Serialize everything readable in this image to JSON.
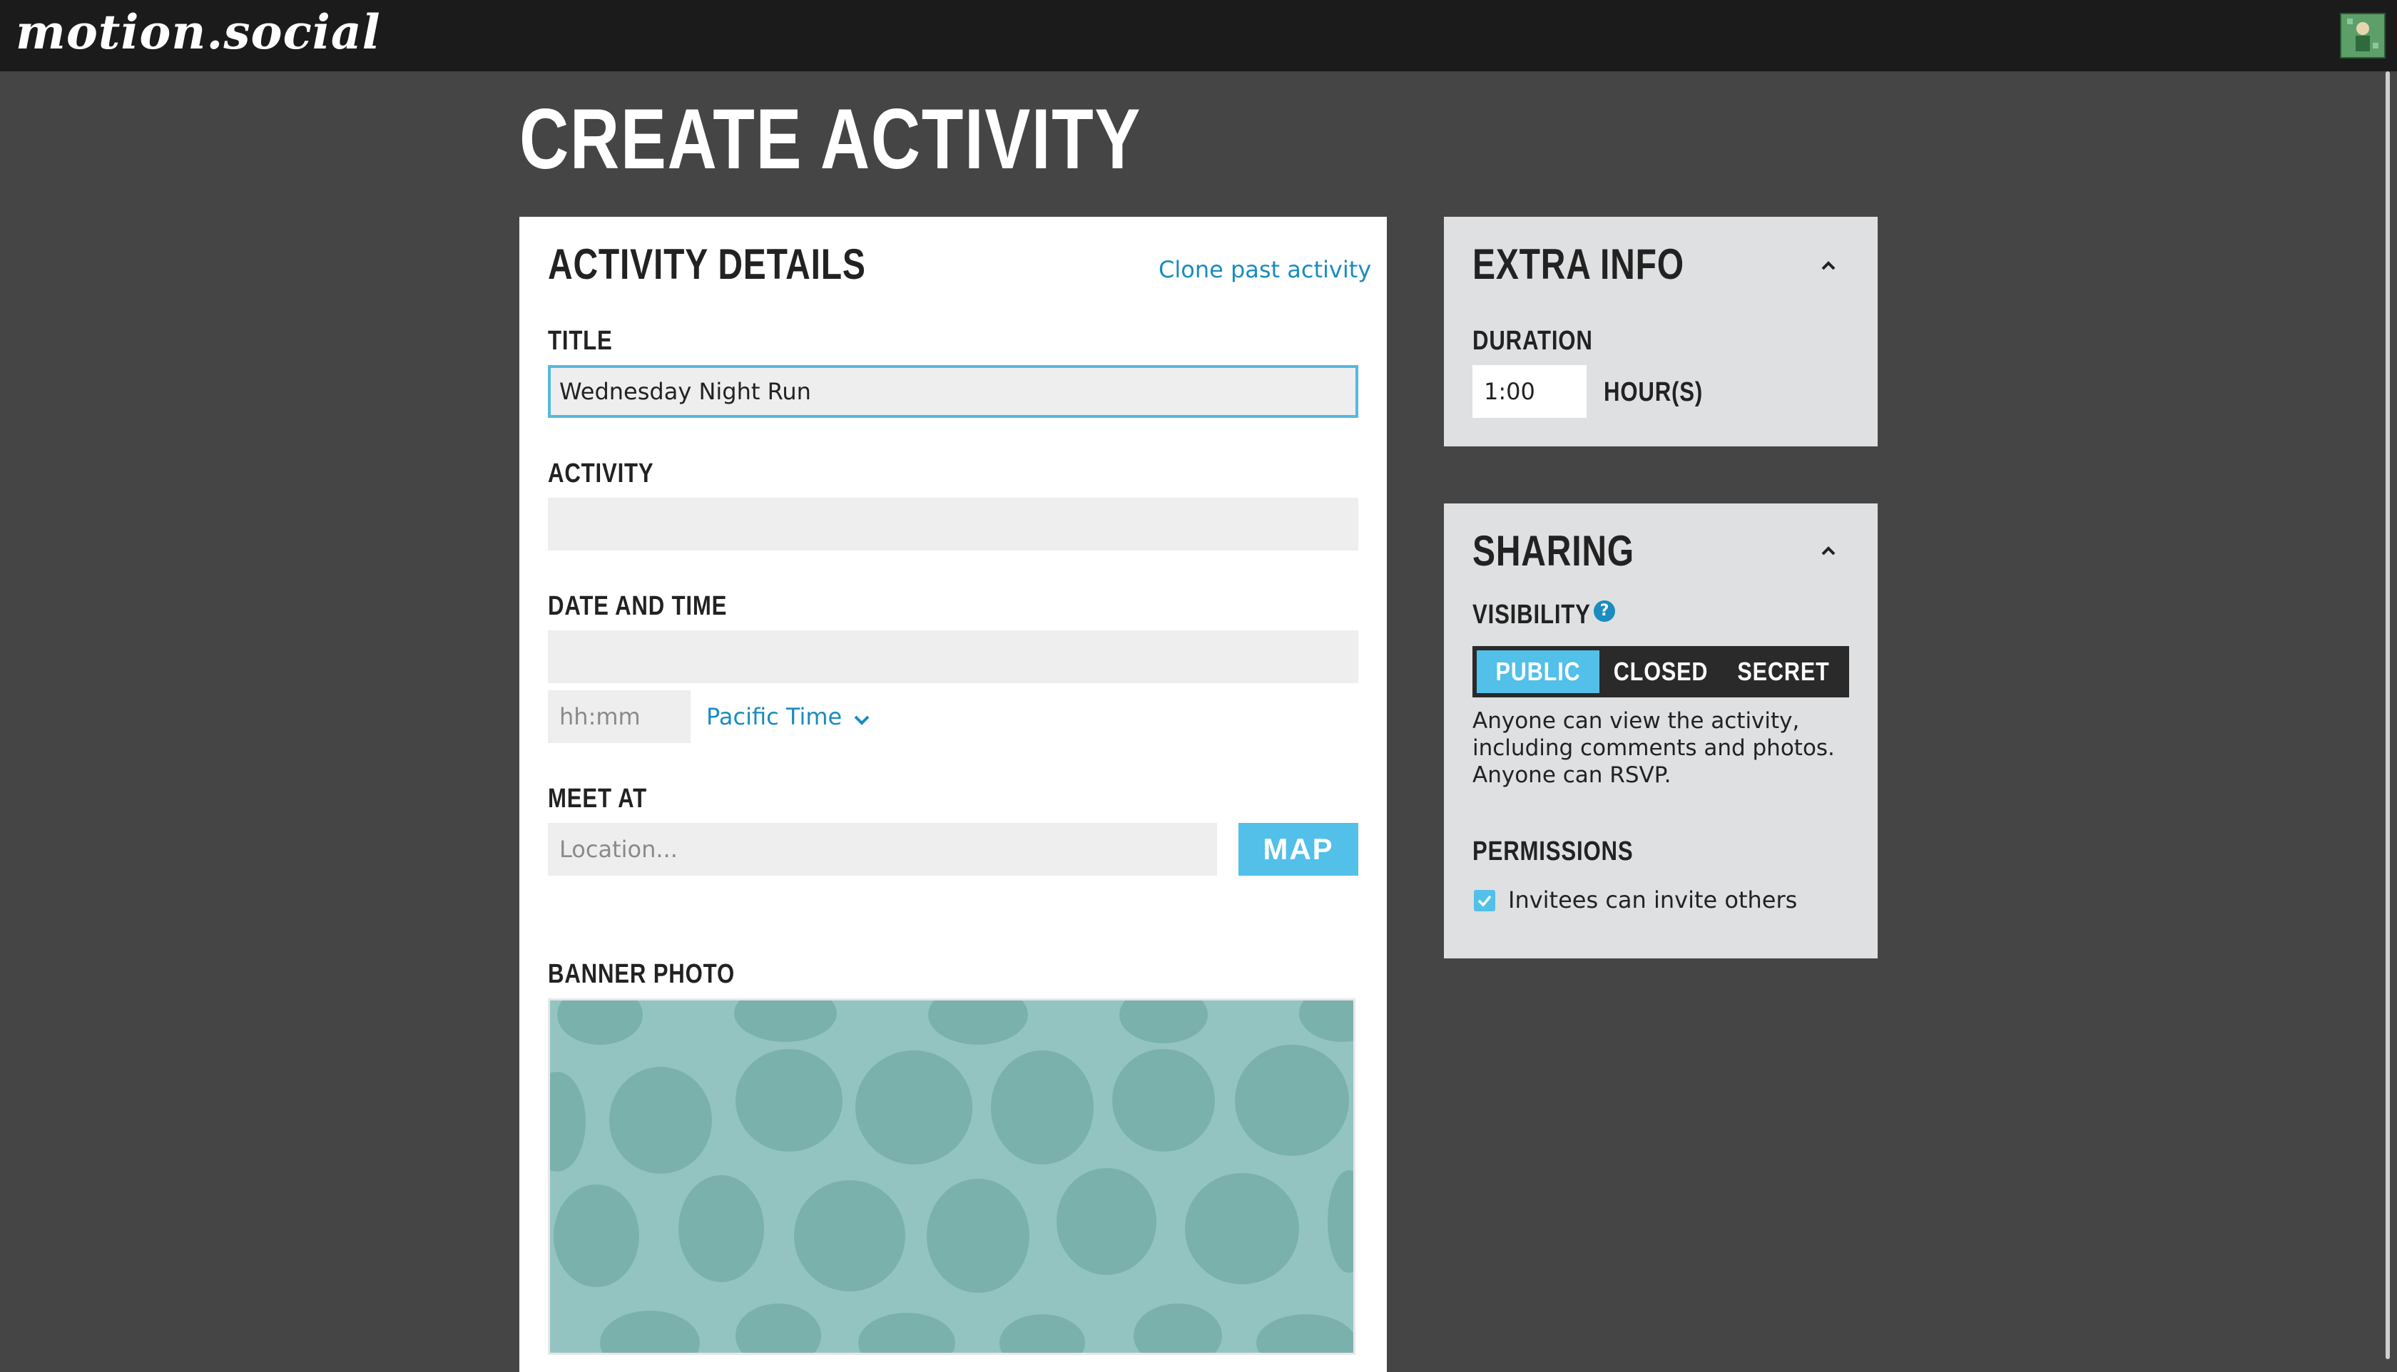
{
  "app": {
    "logo": "motion.social"
  },
  "page": {
    "title": "CREATE ACTIVITY"
  },
  "details": {
    "heading": "ACTIVITY DETAILS",
    "clone_link": "Clone past activity",
    "title_label": "TITLE",
    "title_value": "Wednesday Night Run",
    "activity_label": "ACTIVITY",
    "activity_value": "",
    "datetime_label": "DATE AND TIME",
    "date_value": "",
    "time_placeholder": "hh:mm",
    "timezone": "Pacific Time",
    "meet_label": "MEET AT",
    "location_placeholder": "Location...",
    "map_button": "MAP",
    "banner_label": "BANNER PHOTO"
  },
  "extra": {
    "heading": "EXTRA INFO",
    "duration_label": "DURATION",
    "duration_value": "1:00",
    "duration_unit": "HOUR(S)"
  },
  "sharing": {
    "heading": "SHARING",
    "visibility_label": "VISIBILITY",
    "help_icon": "?",
    "options": [
      "PUBLIC",
      "CLOSED",
      "SECRET"
    ],
    "selected": "PUBLIC",
    "description": "Anyone can view the activity, including comments and photos. Anyone can RSVP.",
    "permissions_label": "PERMISSIONS",
    "invite_checkbox_label": "Invitees can invite others",
    "invite_checked": true
  },
  "colors": {
    "accent": "#52c0e8",
    "link": "#1a8cbf",
    "background": "#454545",
    "topbar": "#1b1b1b",
    "panel": "#dfe0e2",
    "banner": "#93c4c1",
    "banner_spots": "#7ab1ad"
  },
  "icons": {
    "collapse": "chevron-up-icon",
    "timezone_dropdown": "chevron-down-icon",
    "help": "help-icon",
    "check": "check-icon"
  }
}
